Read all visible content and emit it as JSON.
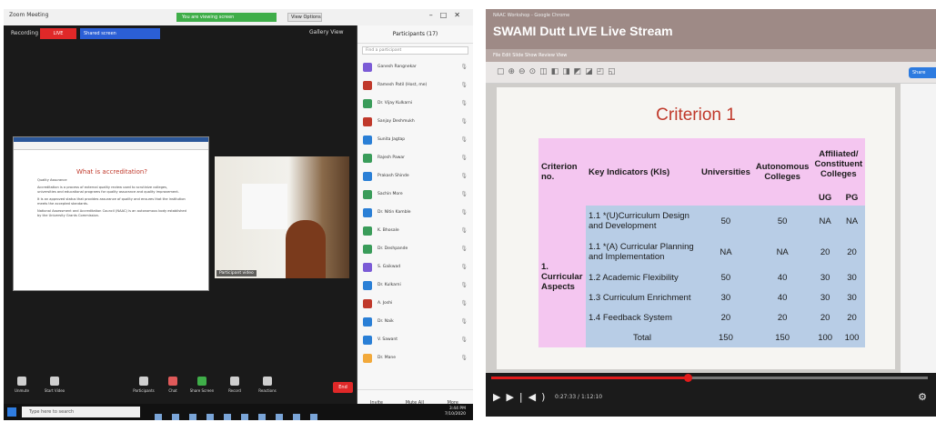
{
  "zoom": {
    "window_title": "Zoom Meeting",
    "green_banner": "You are viewing screen",
    "view_options": "View Options",
    "recording_label": "Recording",
    "badge": "LIVE",
    "share_label": "Shared screen",
    "gallery_view": "Gallery View",
    "shared_doc": {
      "title": "What is accreditation?",
      "paragraphs": [
        "Quality Assurance",
        "Accreditation is a process of external quality review used to scrutinize colleges, universities and educational programs for quality assurance and quality improvement.",
        "It is an approved status that provides assurance of quality and ensures that the institution meets the accepted standards.",
        "National Assessment and Accreditation Council (NAAC) is an autonomous body established by the University Grants Commission."
      ]
    },
    "video_name": "Participant video",
    "participants": {
      "header": "Participants (17)",
      "search_placeholder": "Find a participant",
      "rows": [
        {
          "name": "Ganesh Rangnekar",
          "color": "#7b5bd6"
        },
        {
          "name": "Ramesh Patil (Host, me)",
          "color": "#c0392b"
        },
        {
          "name": "Dr. Vijay Kulkarni",
          "color": "#3a9c5a"
        },
        {
          "name": "Sanjay Deshmukh",
          "color": "#c0392b"
        },
        {
          "name": "Sunita Jagtap",
          "color": "#2a7fd6"
        },
        {
          "name": "Rajesh Pawar",
          "color": "#3a9c5a"
        },
        {
          "name": "Prakash Shinde",
          "color": "#2a7fd6"
        },
        {
          "name": "Sachin More",
          "color": "#3a9c5a"
        },
        {
          "name": "Dr. Nitin Kamble",
          "color": "#2a7fd6"
        },
        {
          "name": "K. Bhosale",
          "color": "#3a9c5a"
        },
        {
          "name": "Dr. Deshpande",
          "color": "#3a9c5a"
        },
        {
          "name": "S. Gaikwad",
          "color": "#7b5bd6"
        },
        {
          "name": "Dr. Kulkarni",
          "color": "#2a7fd6"
        },
        {
          "name": "A. Joshi",
          "color": "#c0392b"
        },
        {
          "name": "Dr. Naik",
          "color": "#2a7fd6"
        },
        {
          "name": "V. Sawant",
          "color": "#2a7fd6"
        },
        {
          "name": "Dr. Mane",
          "color": "#f2a93b"
        }
      ],
      "footer": [
        "Invite",
        "Mute All",
        "More"
      ]
    },
    "controls": [
      "Unmute",
      "Start Video",
      "Participants",
      "Chat",
      "Share Screen",
      "Record",
      "Reactions"
    ],
    "end": "End",
    "taskbar": {
      "search": "Type here to search",
      "clock_time": "3:44 PM",
      "clock_date": "7/10/2020"
    }
  },
  "youtube": {
    "top_small": "NAAC Workshop - Google Chrome",
    "title": "SWAMI Dutt LIVE Live Stream",
    "menu": "File   Edit   Slide Show   Review   View",
    "toolbar_button": "Share",
    "progress": 0.45,
    "time": "0:27:33 / 1:12:10",
    "slide": {
      "title": "Criterion 1",
      "header": {
        "c0": "Criterion no.",
        "c1": "Key Indicators (KIs)",
        "c2": "Universities",
        "c3": "Autonomous Colleges",
        "c4": "Affiliated/ Constituent Colleges",
        "c4a": "UG",
        "c4b": "PG"
      },
      "criterion_label": "1. Curricular Aspects",
      "rows": [
        {
          "ki": "1.1 *(U)Curriculum Design and Development",
          "u": "50",
          "a": "50",
          "ug": "NA",
          "pg": "NA"
        },
        {
          "ki": "1.1 *(A) Curricular Planning and Implementation",
          "u": "NA",
          "a": "NA",
          "ug": "20",
          "pg": "20"
        },
        {
          "ki": "1.2 Academic Flexibility",
          "u": "50",
          "a": "40",
          "ug": "30",
          "pg": "30"
        },
        {
          "ki": "1.3 Curriculum Enrichment",
          "u": "30",
          "a": "40",
          "ug": "30",
          "pg": "30"
        },
        {
          "ki": "1.4 Feedback System",
          "u": "20",
          "a": "20",
          "ug": "20",
          "pg": "20"
        },
        {
          "ki": "Total",
          "u": "150",
          "a": "150",
          "ug": "100",
          "pg": "100"
        }
      ]
    }
  }
}
